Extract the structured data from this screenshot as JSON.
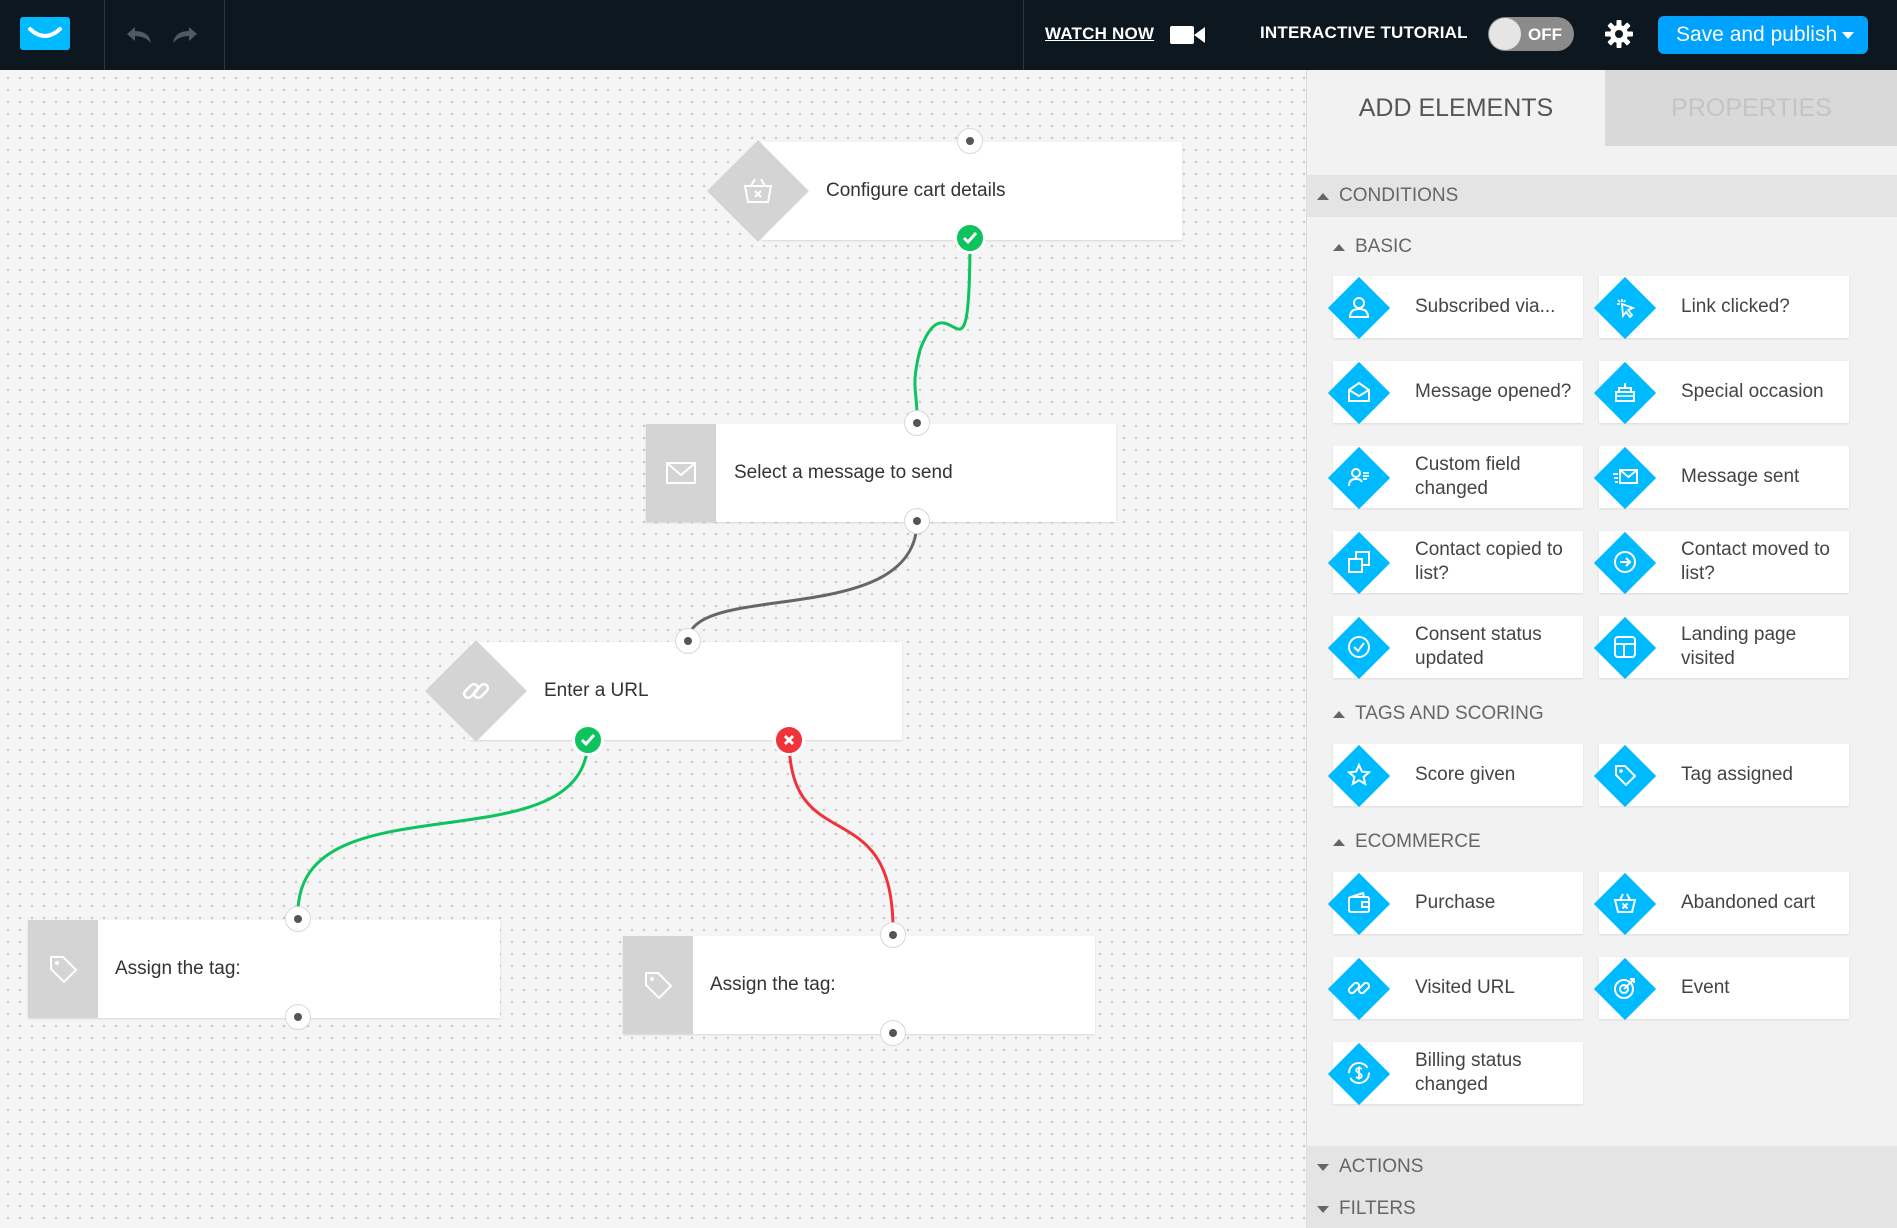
{
  "topbar": {
    "watch_now": "WATCH NOW",
    "tutorial": "INTERACTIVE TUTORIAL",
    "toggle_state": "OFF",
    "publish": "Save and publish"
  },
  "canvas": {
    "nodes": {
      "cart": "Configure cart details",
      "message": "Select a message to send",
      "url": "Enter a URL",
      "tag1": "Assign the tag:",
      "tag2": "Assign the tag:"
    }
  },
  "panel": {
    "tabs": {
      "add": "ADD ELEMENTS",
      "properties": "PROPERTIES"
    },
    "sections": {
      "conditions": "CONDITIONS",
      "actions": "ACTIONS",
      "filters": "FILTERS"
    },
    "groups": {
      "basic": "BASIC",
      "tags": "TAGS AND SCORING",
      "ecommerce": "ECOMMERCE"
    },
    "items": {
      "subscribed": "Subscribed via...",
      "link_clicked": "Link clicked?",
      "message_opened": "Message opened?",
      "special_occasion": "Special occasion",
      "custom_field": "Custom field changed",
      "message_sent": "Message sent",
      "contact_copied": "Contact copied to list?",
      "contact_moved": "Contact moved to list?",
      "consent": "Consent status updated",
      "landing": "Landing page visited",
      "score": "Score given",
      "tag_assigned": "Tag assigned",
      "purchase": "Purchase",
      "abandoned": "Abandoned cart",
      "visited_url": "Visited URL",
      "event": "Event",
      "billing": "Billing status changed"
    }
  },
  "colors": {
    "accent": "#00baff",
    "yes": "#0dc35e",
    "no": "#f0323b",
    "topbar": "#0c1720"
  }
}
